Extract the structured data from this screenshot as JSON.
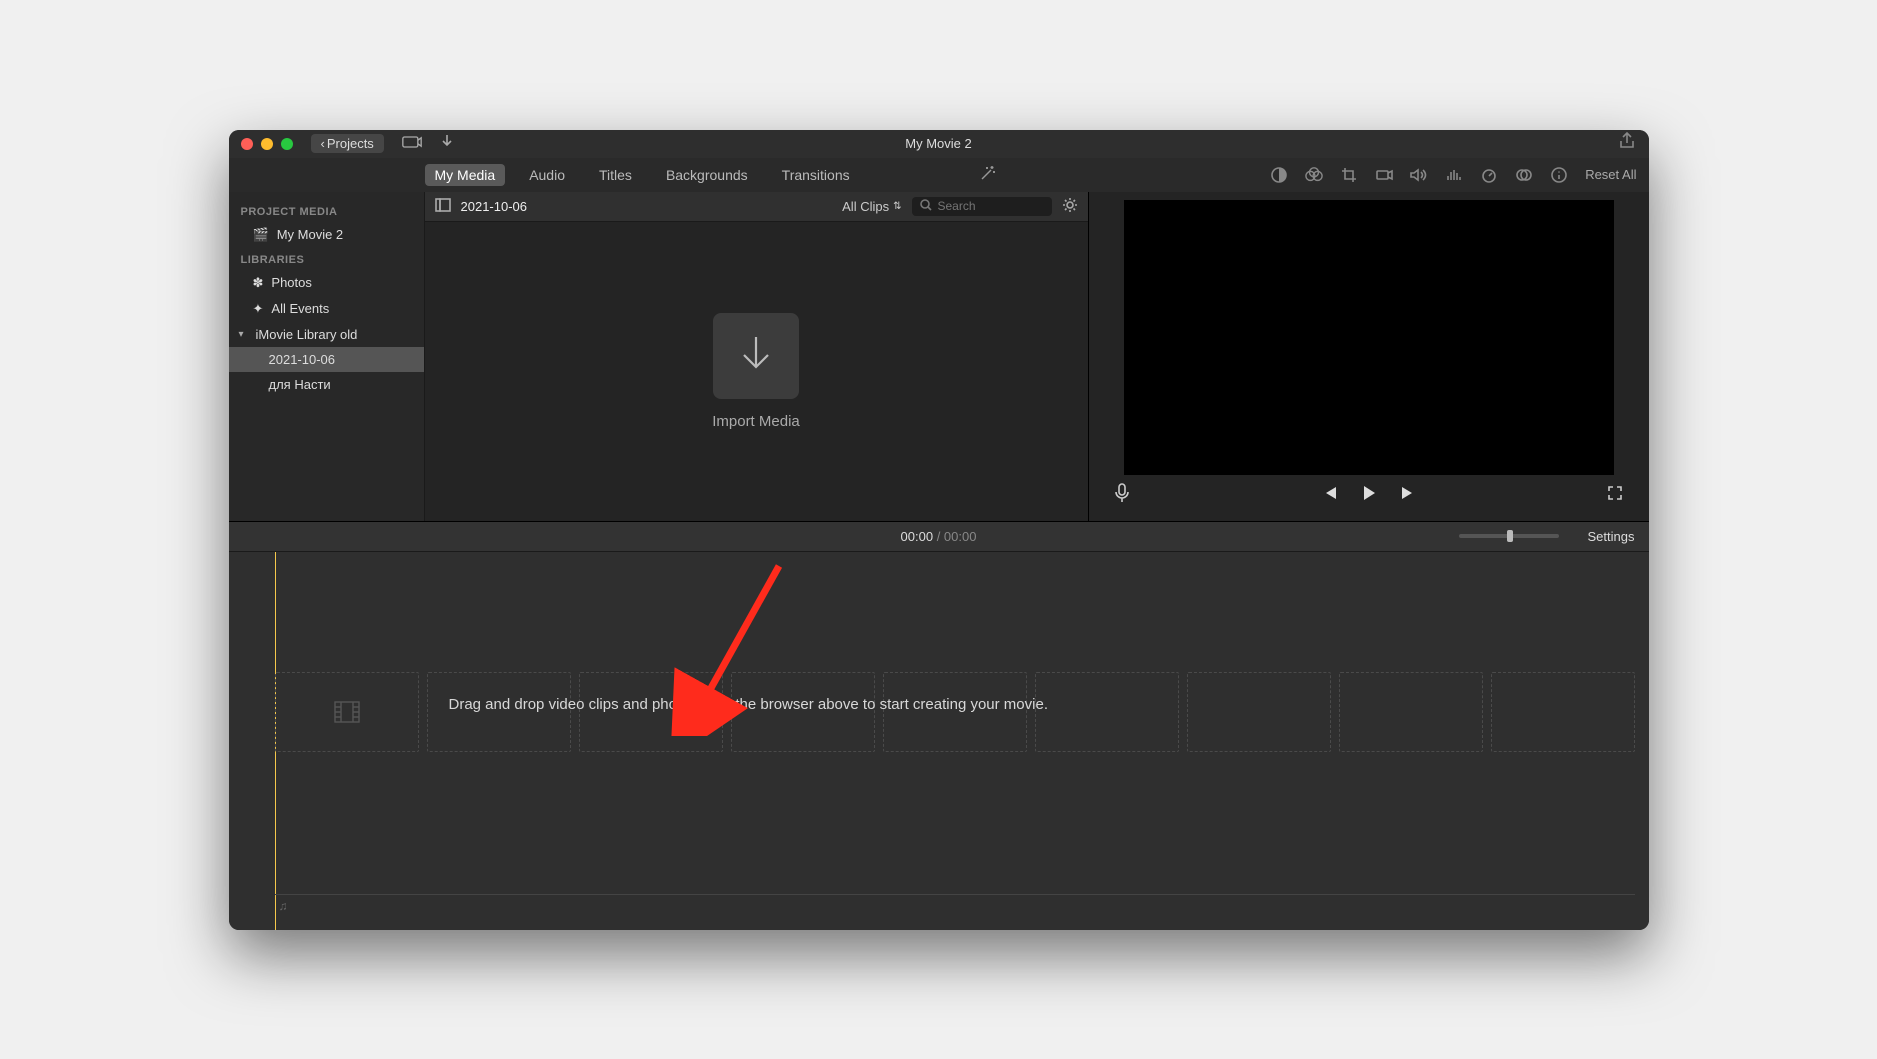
{
  "title": "My Movie 2",
  "projects_button": "Projects",
  "media_tabs": [
    "My Media",
    "Audio",
    "Titles",
    "Backgrounds",
    "Transitions"
  ],
  "media_tabs_active": 0,
  "reset_label": "Reset All",
  "sidebar": {
    "project_media_header": "PROJECT MEDIA",
    "project_name": "My Movie 2",
    "libraries_header": "LIBRARIES",
    "photos": "Photos",
    "all_events": "All Events",
    "library_name": "iMovie Library old",
    "events": [
      "2021-10-06",
      "для Насти"
    ],
    "selected_event": "2021-10-06"
  },
  "browser": {
    "event_title": "2021-10-06",
    "filter_label": "All Clips",
    "search_placeholder": "Search",
    "import_label": "Import Media"
  },
  "time": {
    "current": "00:00",
    "total": "00:00"
  },
  "settings_label": "Settings",
  "timeline_hint": "Drag and drop video clips and photos from the browser above to start creating your movie."
}
